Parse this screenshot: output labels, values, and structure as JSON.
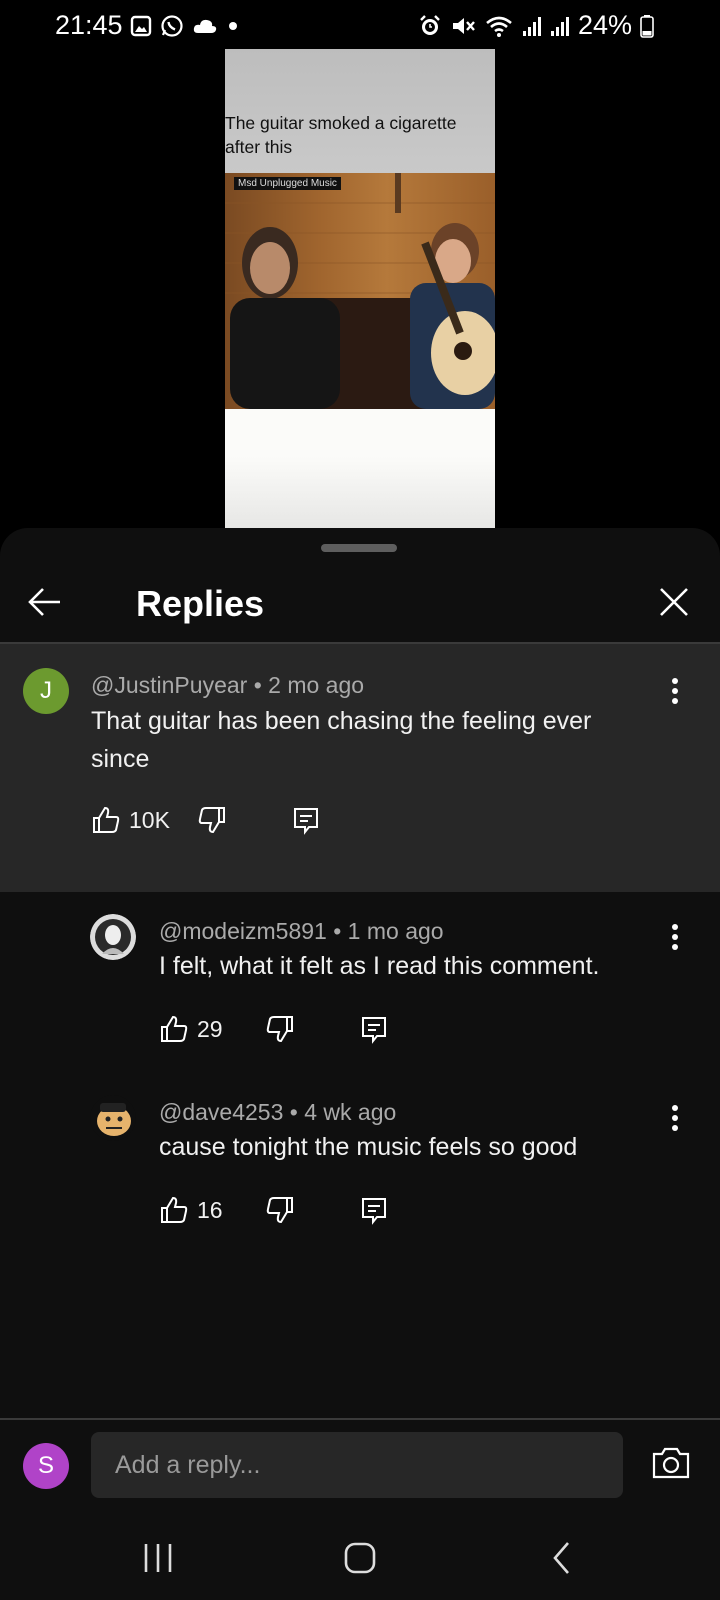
{
  "status_bar": {
    "time": "21:45",
    "battery": "24%",
    "left_icons": [
      "gallery-icon",
      "whatsapp-icon",
      "cloud-icon",
      "dot-icon"
    ],
    "right_icons": [
      "alarm-icon",
      "mute-icon",
      "wifi-icon",
      "signal-icon",
      "signal-icon",
      "battery-icon"
    ]
  },
  "video": {
    "caption": "The guitar smoked a cigarette after this",
    "watermark": "Msd Unplugged Music"
  },
  "sheet": {
    "title": "Replies",
    "back_icon": "arrow-left-icon",
    "close_icon": "close-icon"
  },
  "parent_comment": {
    "avatar_letter": "J",
    "avatar_color": "#6c9a2f",
    "author": "@JustinPuyear",
    "age": "2 mo ago",
    "text": "That guitar has been chasing the feeling ever since",
    "likes": "10K"
  },
  "replies": [
    {
      "author": "@modeizm5891",
      "age": "1 mo ago",
      "text": "I felt, what it felt as I read this comment.",
      "likes": "29"
    },
    {
      "author": "@dave4253",
      "age": "4 wk ago",
      "text": "cause tonight the music feels so good",
      "likes": "16"
    }
  ],
  "reply_bar": {
    "user_initial": "S",
    "user_color": "#b043c8",
    "placeholder": "Add a reply...",
    "camera_icon": "camera-icon"
  },
  "nav_bar": {
    "icons": [
      "recent-apps-icon",
      "home-icon",
      "back-icon"
    ]
  },
  "colors": {
    "sheet_bg": "#0f0f0f",
    "highlight_bg": "#272727",
    "meta_text": "#aaaaaa"
  }
}
